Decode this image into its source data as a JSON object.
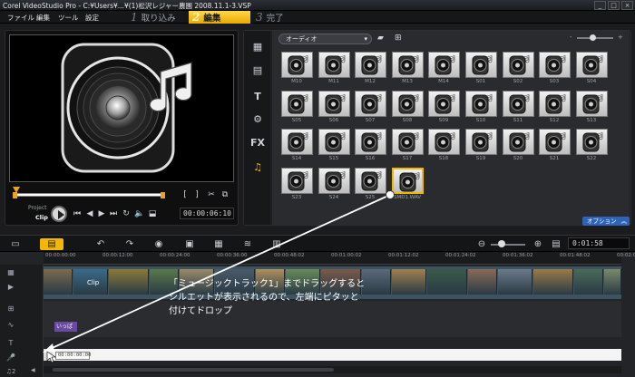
{
  "window": {
    "title": "Corel VideoStudio Pro - C:¥Users¥...¥(1)松沢レジャー農園 2008.11.1-3.VSP"
  },
  "menu": [
    "ファイル",
    "編集",
    "ツール",
    "設定"
  ],
  "steps": [
    {
      "num": "1",
      "label": "取り込み",
      "active": false
    },
    {
      "num": "2",
      "label": "編集",
      "active": true
    },
    {
      "num": "3",
      "label": "完了",
      "active": false
    }
  ],
  "preview": {
    "mode_project": "Project",
    "mode_clip": "Clip",
    "timecode": "00:00:06:10"
  },
  "library": {
    "category": "オーディオ",
    "options_label": "オプション",
    "items": [
      "M10",
      "M11",
      "M12",
      "M13",
      "M14",
      "S01",
      "S02",
      "S03",
      "S04",
      "S05",
      "S06",
      "S07",
      "S08",
      "S09",
      "S10",
      "S11",
      "S12",
      "S13",
      "S14",
      "S15",
      "S16",
      "S17",
      "S18",
      "S19",
      "S20",
      "S21",
      "S22",
      "S23",
      "S24",
      "S25",
      "SMD1.WAV"
    ]
  },
  "timeline": {
    "timecode": "0:01:58",
    "ticks": [
      "00:00:00:00",
      "00:00:12:00",
      "00:00:24:00",
      "00:00:36:00",
      "00:00:48:02",
      "00:01:00:02",
      "00:01:12:02",
      "00:01:24:02",
      "00:01:36:02",
      "00:01:48:02",
      "00:02:00:04"
    ],
    "clip_label": "Clip",
    "title_clip": "いっぱ",
    "silhouette_timecode": "00:00:00:00"
  },
  "annotation": {
    "lines": [
      "「ミュージックトラック1」までドラッグすると",
      "シルエットが表示されるので、左端にピタッと",
      "付けてドロップ"
    ]
  },
  "colors": {
    "accent": "#f2b800",
    "options": "#2d64b8"
  }
}
